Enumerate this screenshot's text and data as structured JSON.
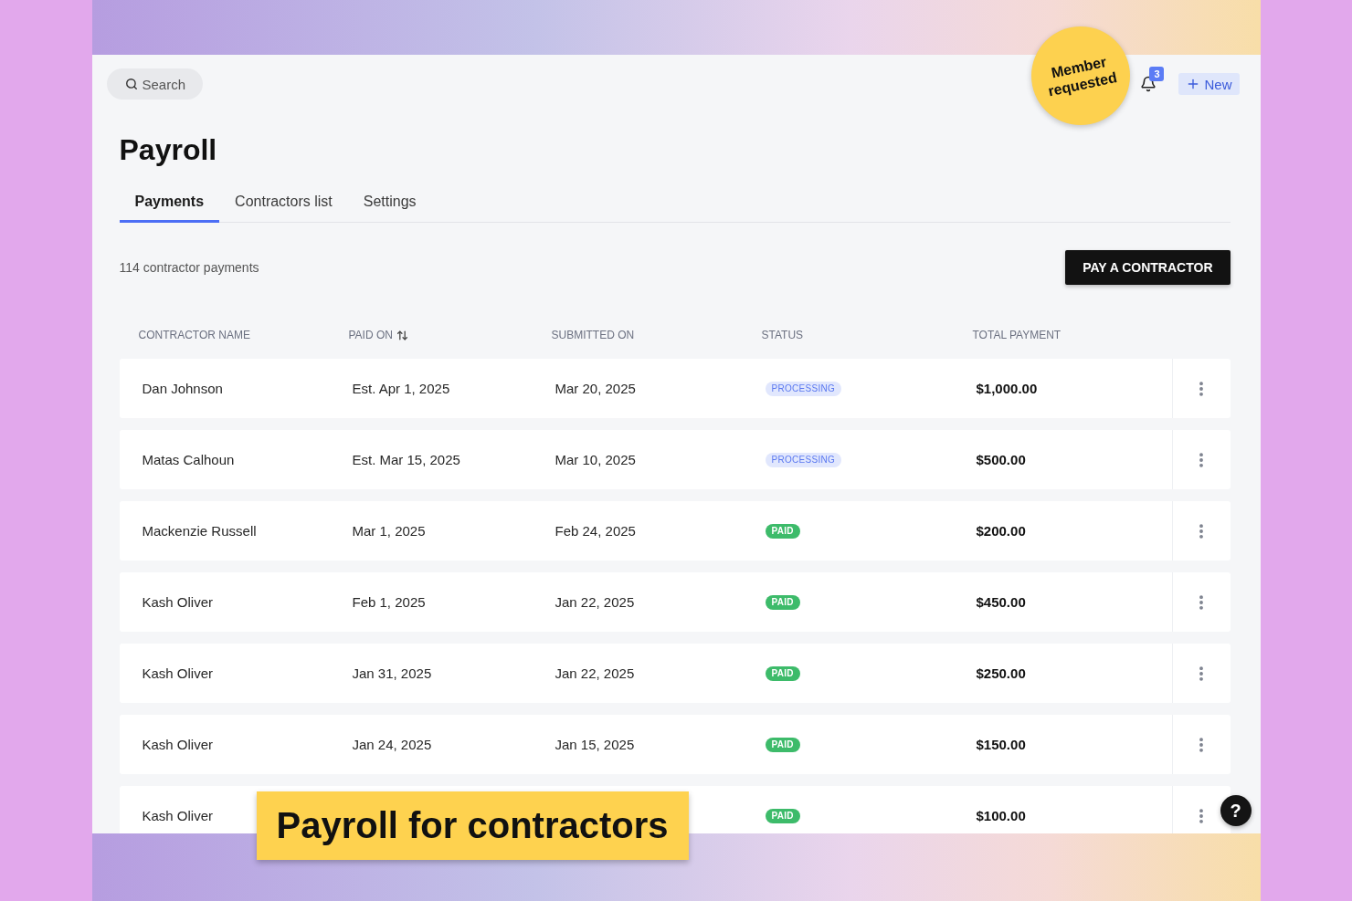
{
  "search": {
    "placeholder": "Search"
  },
  "sticker": {
    "text": "Member requested"
  },
  "notifications": {
    "count": "3"
  },
  "new_button": {
    "label": "New"
  },
  "page_title": "Payroll",
  "tabs": [
    {
      "label": "Payments",
      "selected": true
    },
    {
      "label": "Contractors list",
      "selected": false
    },
    {
      "label": "Settings",
      "selected": false
    }
  ],
  "summary": "114 contractor payments",
  "pay_button": {
    "label": "PAY A CONTRACTOR"
  },
  "table": {
    "columns": [
      {
        "label": "CONTRACTOR NAME",
        "sortable": false
      },
      {
        "label": "PAID ON",
        "sortable": true
      },
      {
        "label": "SUBMITTED ON",
        "sortable": false
      },
      {
        "label": "STATUS",
        "sortable": false
      },
      {
        "label": "TOTAL PAYMENT",
        "sortable": false
      }
    ],
    "rows": [
      {
        "name": "Dan Johnson",
        "paid_on": "Est. Apr 1, 2025",
        "submitted_on": "Mar 20, 2025",
        "status": {
          "label": "PROCESSING",
          "kind": "processing"
        },
        "total": "$1,000.00"
      },
      {
        "name": "Matas Calhoun",
        "paid_on": "Est. Mar 15, 2025",
        "submitted_on": "Mar 10, 2025",
        "status": {
          "label": "PROCESSING",
          "kind": "processing"
        },
        "total": "$500.00"
      },
      {
        "name": "Mackenzie Russell",
        "paid_on": "Mar 1, 2025",
        "submitted_on": "Feb 24, 2025",
        "status": {
          "label": "PAID",
          "kind": "paid"
        },
        "total": "$200.00"
      },
      {
        "name": "Kash Oliver",
        "paid_on": "Feb 1, 2025",
        "submitted_on": "Jan 22, 2025",
        "status": {
          "label": "PAID",
          "kind": "paid"
        },
        "total": "$450.00"
      },
      {
        "name": "Kash Oliver",
        "paid_on": "Jan 31, 2025",
        "submitted_on": "Jan 22, 2025",
        "status": {
          "label": "PAID",
          "kind": "paid"
        },
        "total": "$250.00"
      },
      {
        "name": "Kash Oliver",
        "paid_on": "Jan 24, 2025",
        "submitted_on": "Jan 15, 2025",
        "status": {
          "label": "PAID",
          "kind": "paid"
        },
        "total": "$150.00"
      },
      {
        "name": "Kash Oliver",
        "status": {
          "label": "PAID",
          "kind": "paid"
        },
        "total": "$100.00"
      }
    ]
  },
  "caption": "Payroll for contractors",
  "help_button": {
    "label": "?"
  }
}
